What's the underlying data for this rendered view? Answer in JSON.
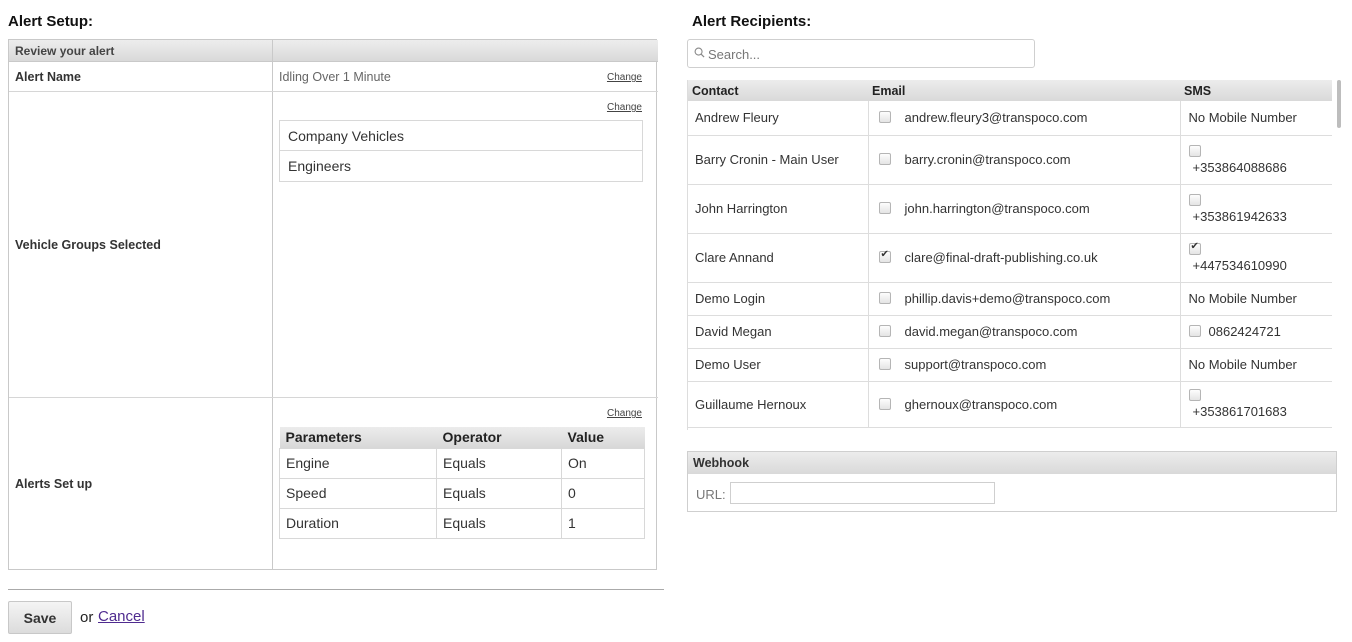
{
  "setup": {
    "title": "Alert Setup:",
    "review_header": "Review your alert",
    "alert_name_label": "Alert Name",
    "alert_name_value": "Idling Over 1 Minute",
    "change_label": "Change",
    "vehicle_groups_label": "Vehicle Groups Selected",
    "vehicle_groups": [
      "Company Vehicles",
      "Engineers"
    ],
    "alerts_setup_label": "Alerts Set up",
    "param_headers": [
      "Parameters",
      "Operator",
      "Value"
    ],
    "params": [
      [
        "Engine",
        "Equals",
        "On"
      ],
      [
        "Speed",
        "Equals",
        "0"
      ],
      [
        "Duration",
        "Equals",
        "1"
      ]
    ]
  },
  "footer": {
    "save_label": "Save",
    "or_text": "or",
    "cancel_label": "Cancel"
  },
  "recipients": {
    "title": "Alert Recipients:",
    "search_placeholder": "Search...",
    "headers": [
      "Contact",
      "Email",
      "SMS"
    ],
    "rows": [
      {
        "contact": "Andrew Fleury",
        "email": "andrew.fleury3@transpoco.com",
        "email_checked": false,
        "sms": "No Mobile Number",
        "sms_checkbox": false,
        "sms_checked": false,
        "sms_inline": false
      },
      {
        "contact": "Barry Cronin - Main User",
        "email": "barry.cronin@transpoco.com",
        "email_checked": false,
        "sms": "+353864088686",
        "sms_checkbox": true,
        "sms_checked": false,
        "sms_inline": false
      },
      {
        "contact": "John Harrington",
        "email": "john.harrington@transpoco.com",
        "email_checked": false,
        "sms": "+353861942633",
        "sms_checkbox": true,
        "sms_checked": false,
        "sms_inline": false
      },
      {
        "contact": "Clare Annand",
        "email": "clare@final-draft-publishing.co.uk",
        "email_checked": true,
        "sms": "+447534610990",
        "sms_checkbox": true,
        "sms_checked": true,
        "sms_inline": false
      },
      {
        "contact": "Demo Login",
        "email": "phillip.davis+demo@transpoco.com",
        "email_checked": false,
        "sms": "No Mobile Number",
        "sms_checkbox": false,
        "sms_checked": false,
        "sms_inline": false
      },
      {
        "contact": "David Megan",
        "email": "david.megan@transpoco.com",
        "email_checked": false,
        "sms": "0862424721",
        "sms_checkbox": true,
        "sms_checked": false,
        "sms_inline": true
      },
      {
        "contact": "Demo User",
        "email": "support@transpoco.com",
        "email_checked": false,
        "sms": "No Mobile Number",
        "sms_checkbox": false,
        "sms_checked": false,
        "sms_inline": false
      },
      {
        "contact": "Guillaume Hernoux",
        "email": "ghernoux@transpoco.com",
        "email_checked": false,
        "sms": "+353861701683",
        "sms_checkbox": true,
        "sms_checked": false,
        "sms_inline": false
      }
    ]
  },
  "webhook": {
    "header": "Webhook",
    "url_label": "URL:",
    "url_value": ""
  }
}
